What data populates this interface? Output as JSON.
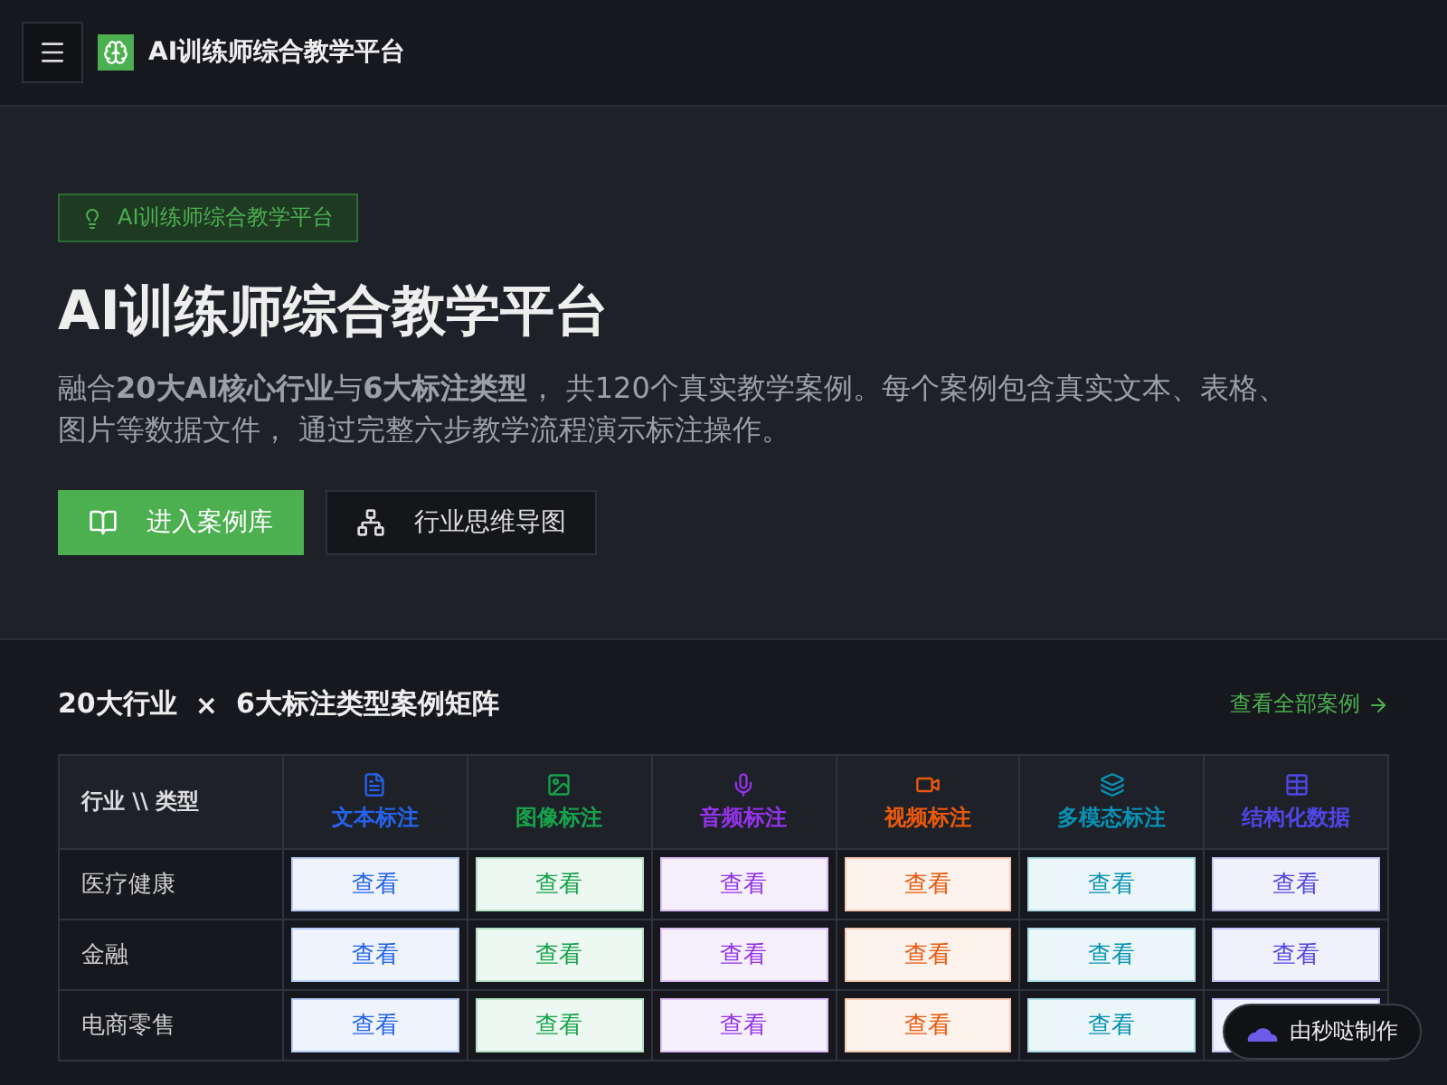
{
  "header": {
    "title": "AI训练师综合教学平台"
  },
  "hero": {
    "badge": "AI训练师综合教学平台",
    "title": "AI训练师综合教学平台",
    "description": "融合**20大AI核心行业**与**6大标注类型**， 共120个真实教学案例。每个案例包含真实文本、表格、图片等数据文件， 通过完整六步教学流程演示标注操作。",
    "buttons": [
      {
        "label": "进入案例库",
        "kind": "primary"
      },
      {
        "label": "行业思维导图",
        "kind": "secondary"
      }
    ]
  },
  "matrix": {
    "title_left": "20大行业",
    "times": "×",
    "title_right": "6大标注类型案例矩阵",
    "view_all": "查看全部案例",
    "corner": "行业 \\\\ 类型",
    "columns": [
      {
        "label": "文本标注",
        "kind": "text",
        "color": "#2563eb"
      },
      {
        "label": "图像标注",
        "kind": "image",
        "color": "#16a34a"
      },
      {
        "label": "音频标注",
        "kind": "audio",
        "color": "#9333ea"
      },
      {
        "label": "视频标注",
        "kind": "video",
        "color": "#ea580c"
      },
      {
        "label": "多模态标注",
        "kind": "layers",
        "color": "#0891b2"
      },
      {
        "label": "结构化数据",
        "kind": "table",
        "color": "#4f46e5"
      }
    ],
    "rows": [
      {
        "industry": "医疗健康",
        "cells": [
          "查看",
          "查看",
          "查看",
          "查看",
          "查看",
          "查看"
        ]
      },
      {
        "industry": "金融",
        "cells": [
          "查看",
          "查看",
          "查看",
          "查看",
          "查看",
          "查看"
        ]
      },
      {
        "industry": "电商零售",
        "cells": [
          "查看",
          "查看",
          "查看",
          "查看",
          "查看",
          null
        ]
      }
    ]
  },
  "made_by": "由秒哒制作"
}
